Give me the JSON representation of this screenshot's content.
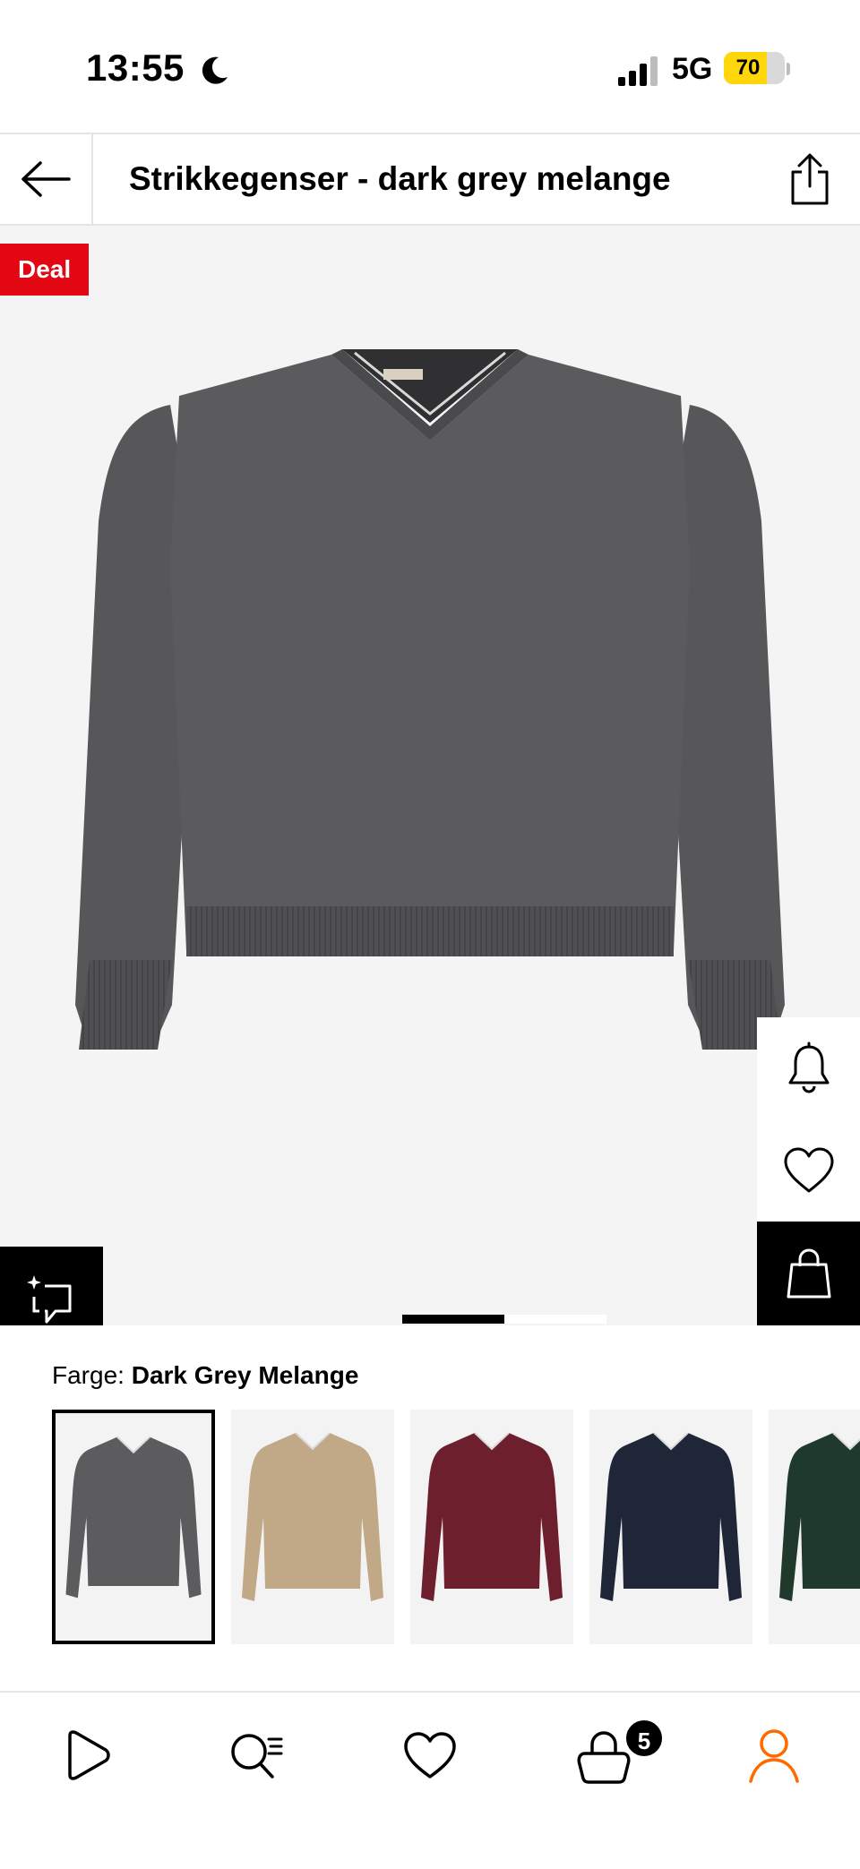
{
  "status_bar": {
    "time": "13:55",
    "network": "5G",
    "battery": "70",
    "battery_level": 0.7,
    "icons": [
      "moon-icon",
      "signal-icon",
      "battery-icon"
    ]
  },
  "header": {
    "title": "Strikkegenser - dark grey melange",
    "back_icon": "arrow-left-icon",
    "share_icon": "share-icon"
  },
  "product": {
    "badge": "Deal",
    "badge_color": "#e30613",
    "image_background": "#f4f4f4",
    "sweater_color": "#58585a",
    "side_actions": [
      "bell-icon",
      "heart-icon",
      "bag-icon"
    ],
    "similar_icon": "similar-search-icon",
    "pager": {
      "pages": 3,
      "active": 1
    }
  },
  "color_selector": {
    "label": "Farge:",
    "selected": "Dark Grey Melange",
    "swatches": [
      {
        "name": "Dark Grey Melange",
        "color": "#5c5c5e",
        "selected": true
      },
      {
        "name": "Beige",
        "color": "#c1a886",
        "selected": false
      },
      {
        "name": "Burgundy",
        "color": "#6e1f2e",
        "selected": false
      },
      {
        "name": "Navy",
        "color": "#1f2638",
        "selected": false
      },
      {
        "name": "Green",
        "color": "#1f3a2c",
        "selected": false
      }
    ]
  },
  "bottom_nav": {
    "items": [
      "home-icon",
      "search-icon",
      "wishlist-icon",
      "cart-icon",
      "profile-icon"
    ],
    "cart_count": "5",
    "accent": "#ff6900"
  }
}
